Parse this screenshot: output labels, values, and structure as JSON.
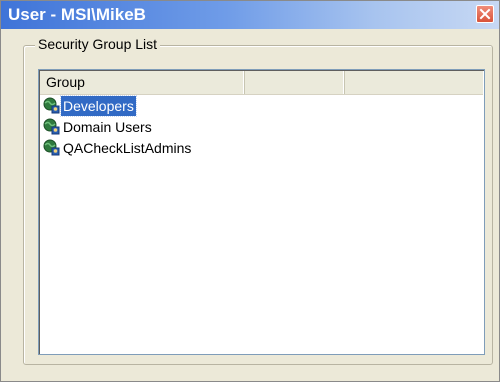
{
  "window": {
    "title": "User - MSI\\MikeB",
    "close_icon": "close-icon"
  },
  "groupbox": {
    "legend": "Security Group List"
  },
  "list": {
    "columns": [
      "Group",
      ""
    ],
    "rows": [
      {
        "label": "Developers",
        "icon": "security-group-icon",
        "selected": true
      },
      {
        "label": "Domain Users",
        "icon": "security-group-icon",
        "selected": false
      },
      {
        "label": "QACheckListAdmins",
        "icon": "security-group-icon",
        "selected": false
      }
    ]
  },
  "colors": {
    "selection": "#316ac5",
    "titlebar_start": "#3f74d8",
    "window_background": "#ece9d8",
    "close_button": "#d9533a"
  }
}
